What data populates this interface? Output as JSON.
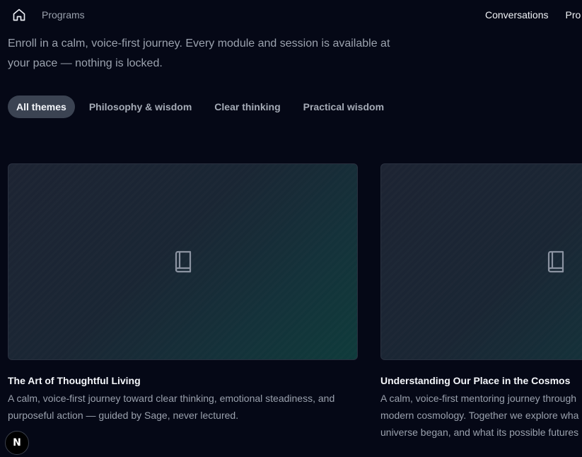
{
  "topbar": {
    "home_icon": "home-icon",
    "breadcrumb": "Programs",
    "nav": [
      "Conversations",
      "Pro"
    ]
  },
  "intro": "Enroll in a calm, voice-first journey. Every module and session is available at your pace — nothing is locked.",
  "tabs": [
    {
      "label": "All themes",
      "active": true
    },
    {
      "label": "Philosophy & wisdom",
      "active": false
    },
    {
      "label": "Clear thinking",
      "active": false
    },
    {
      "label": "Practical wisdom",
      "active": false
    }
  ],
  "programs": [
    {
      "title": "The Art of Thoughtful Living",
      "desc_lines": [
        "A calm, voice-first journey toward clear thinking, emotional steadiness, and",
        "purposeful action — guided by Sage, never lectured."
      ],
      "icon": "book-icon"
    },
    {
      "title": "Understanding Our Place in the Cosmos",
      "desc_lines": [
        "A calm, voice-first mentoring journey through",
        "modern cosmology. Together we explore wha",
        "universe began, and what its possible futures"
      ],
      "icon": "book-icon"
    }
  ],
  "badge": {
    "letter": "N"
  },
  "colors": {
    "background": "#050816",
    "active_tab": "#3b4352",
    "card_gradient_end": "#0f3b3b"
  }
}
